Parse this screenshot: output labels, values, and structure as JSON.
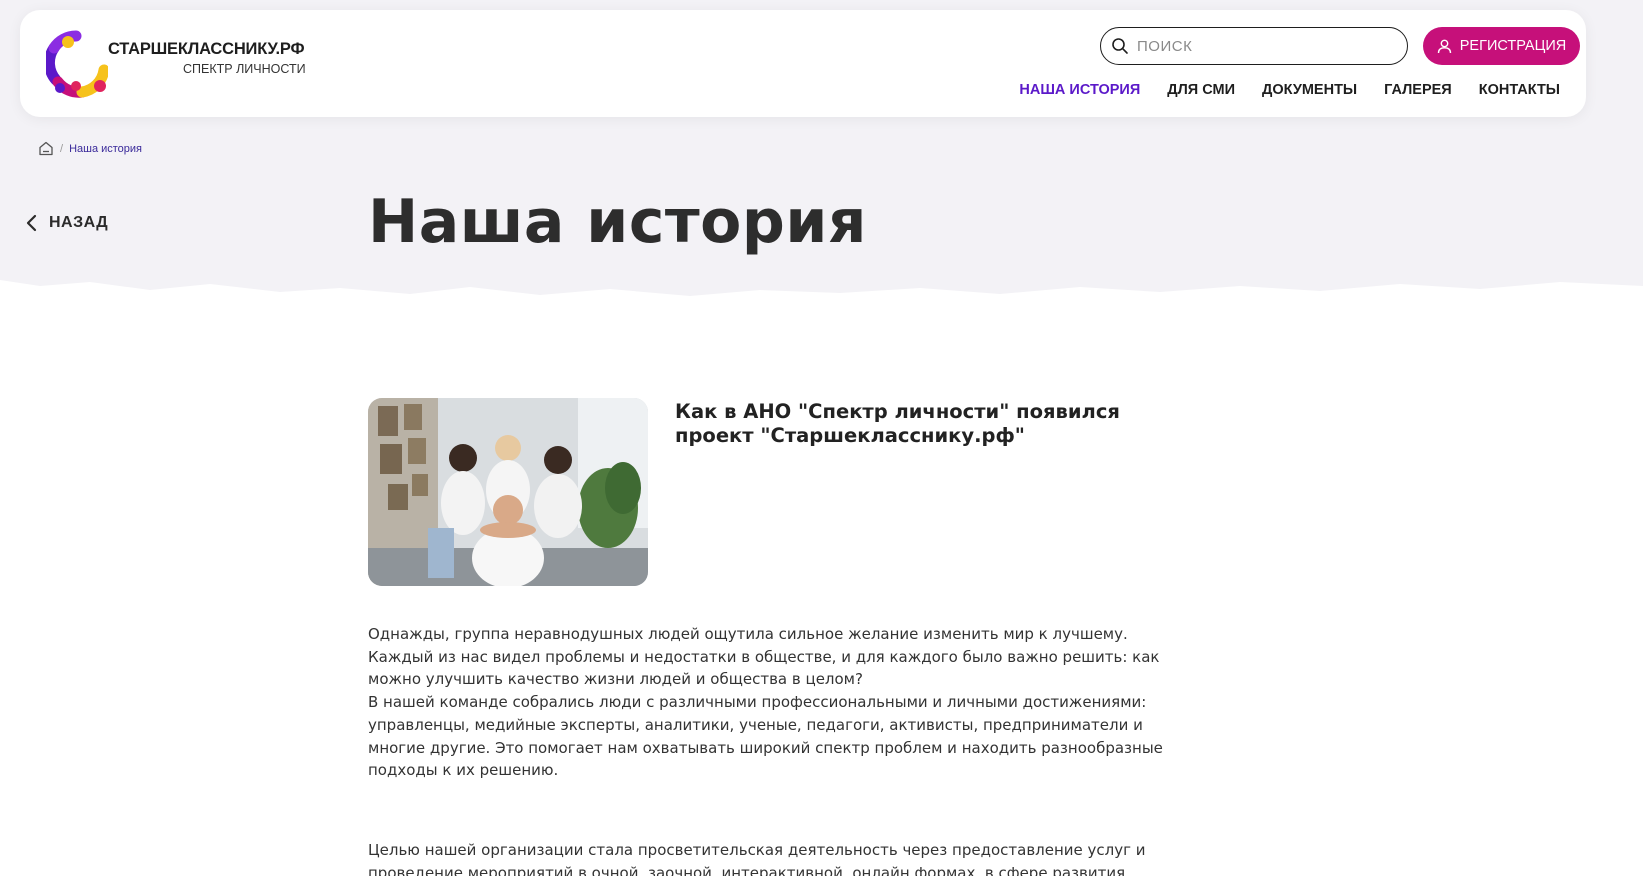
{
  "logo": {
    "title": "СТАРШЕКЛАССНИКУ.РФ",
    "subtitle": "СПЕКТР ЛИЧНОСТИ",
    "icon": "spectrum-ring-logo"
  },
  "search": {
    "placeholder": "ПОИСК",
    "value": "",
    "icon": "search-icon"
  },
  "register": {
    "label": "РЕГИСТРАЦИЯ",
    "icon": "user-icon"
  },
  "nav": {
    "items": [
      {
        "label": "НАША ИСТОРИЯ",
        "active": true
      },
      {
        "label": "ДЛЯ СМИ",
        "active": false
      },
      {
        "label": "ДОКУМЕНТЫ",
        "active": false
      },
      {
        "label": "ГАЛЕРЕЯ",
        "active": false
      },
      {
        "label": "КОНТАКТЫ",
        "active": false
      }
    ]
  },
  "breadcrumb": {
    "separator": "/",
    "current": "Наша история",
    "home_icon": "home-icon"
  },
  "back": {
    "label": "НАЗАД",
    "icon": "chevron-left-icon"
  },
  "page": {
    "title": "Наша история"
  },
  "article": {
    "heading": "Как в АНО \"Спектр личности\" появился проект \"Старшекласснику.рф\"",
    "paragraphs": [
      "Однажды, группа неравнодушных людей ощутила сильное желание изменить мир к лучшему. Каждый из нас видел проблемы и недостатки в обществе, и для каждого было важно решить: как можно улучшить качество жизни людей и общества в целом?",
      "В нашей команде собрались люди с различными профессиональными и личными достижениями: управленцы, медийные эксперты, аналитики, ученые, педагоги, активисты, предприниматели и многие другие. Это помогает нам охватывать широкий спектр проблем и находить разнообразные подходы к их решению.",
      "Целью нашей организации стала просветительская деятельность через предоставление услуг и проведение мероприятий в очной, заочной, интерактивной, онлайн формах, в сфере развития"
    ]
  },
  "colors": {
    "accent": "#c6107a",
    "nav_active": "#5b19c9",
    "hero_bg": "#f3f2f6",
    "logo_purple": "#5b19c9",
    "logo_pink": "#c6107a",
    "logo_yellow": "#f6c21b",
    "logo_red": "#e0245e"
  }
}
